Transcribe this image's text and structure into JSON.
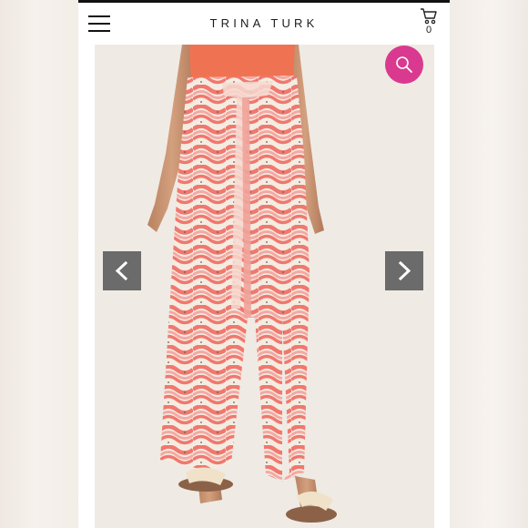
{
  "header": {
    "brand": "TRINA TURK",
    "cart_count": "0"
  },
  "icons": {
    "menu": "hamburger-menu-icon",
    "cart": "shopping-cart-icon",
    "search": "magnifier-icon",
    "prev": "chevron-left-icon",
    "next": "chevron-right-icon"
  },
  "colors": {
    "search_button": "#d93a8f",
    "arrow_button": "#6b6b6b",
    "pattern_coral": "#f0786f",
    "pattern_pink": "#f3a9a3",
    "pattern_cream": "#f4ece1",
    "top_orange": "#ef7352",
    "gallery_background": "#efeae4"
  }
}
